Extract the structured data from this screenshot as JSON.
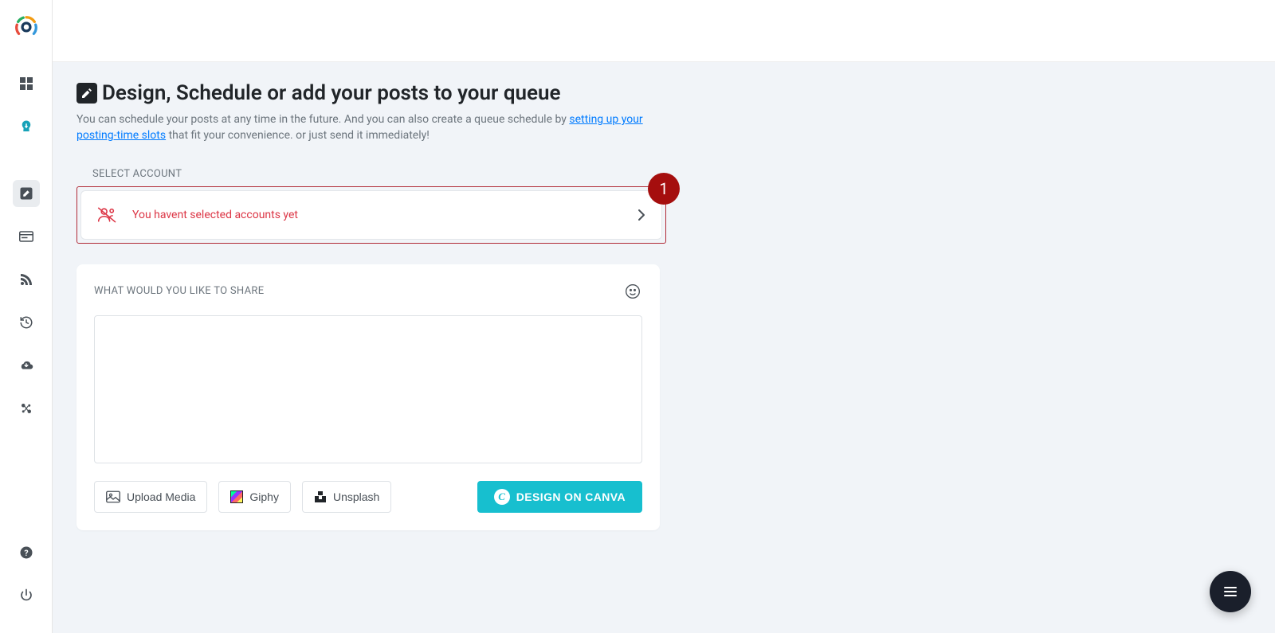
{
  "page": {
    "title": "Design, Schedule or add your posts to your queue",
    "subtitle_prefix": "You can schedule your posts at any time in the future. And you can also create a queue schedule by ",
    "subtitle_link": "setting up your posting-time slots",
    "subtitle_suffix": " that fit your convenience. or just send it immediately!"
  },
  "select_account": {
    "label": "SELECT ACCOUNT",
    "message": "You havent selected accounts yet",
    "step_badge": "1"
  },
  "share": {
    "label": "WHAT WOULD YOU LIKE TO SHARE",
    "textarea_value": ""
  },
  "buttons": {
    "upload": "Upload Media",
    "giphy": "Giphy",
    "unsplash": "Unsplash",
    "canva": "DESIGN ON CANVA",
    "canva_glyph": "C"
  }
}
